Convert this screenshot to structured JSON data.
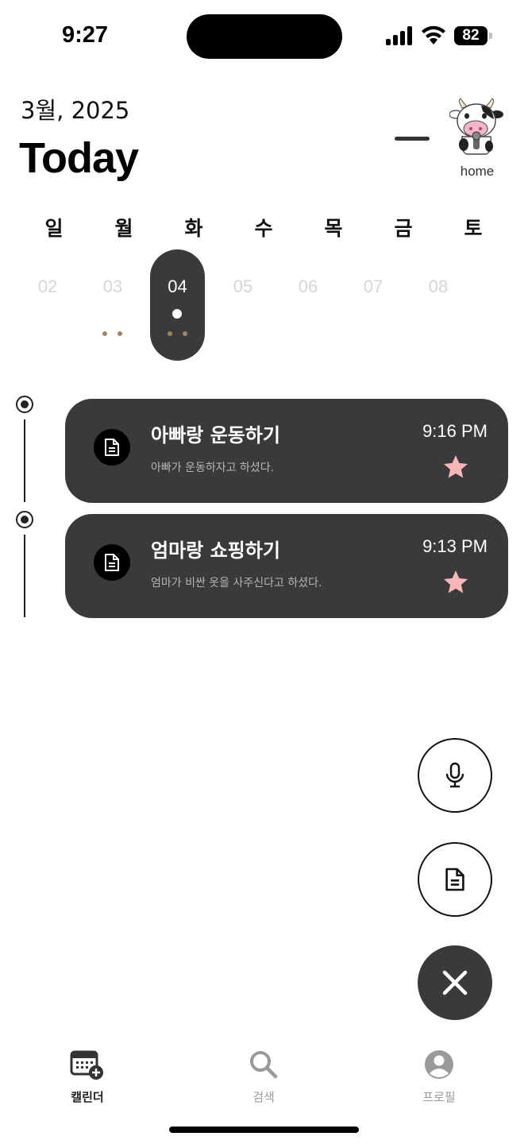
{
  "status_bar": {
    "time": "9:27",
    "battery": "82"
  },
  "header": {
    "month": "3월, 2025",
    "title": "Today",
    "home_label": "home"
  },
  "calendar": {
    "weekdays": [
      "일",
      "월",
      "화",
      "수",
      "목",
      "금",
      "토"
    ],
    "days": [
      "02",
      "03",
      "04",
      "05",
      "06",
      "07",
      "08"
    ],
    "selected_day": "04"
  },
  "entries": [
    {
      "title": "아빠랑 운동하기",
      "description": "아빠가 운동하자고 하셨다.",
      "time": "9:16 PM",
      "icon": "document-icon",
      "starred": true
    },
    {
      "title": "엄마랑 쇼핑하기",
      "description": "엄마가 비싼 옷을 사주신다고 하셨다.",
      "time": "9:13 PM",
      "icon": "document-icon",
      "starred": true
    }
  ],
  "fab": {
    "voice_icon": "microphone-icon",
    "text_icon": "document-icon",
    "close_icon": "close-icon"
  },
  "nav": {
    "calendar": {
      "label": "캘린더",
      "icon": "calendar-add-icon"
    },
    "search": {
      "label": "검색",
      "icon": "search-icon"
    },
    "profile": {
      "label": "프로필",
      "icon": "profile-icon"
    }
  },
  "colors": {
    "card": "#3a3a3c",
    "star": "#f7b6b8",
    "event_dot": "#a08464",
    "inactive_day": "#d6d6d6"
  }
}
